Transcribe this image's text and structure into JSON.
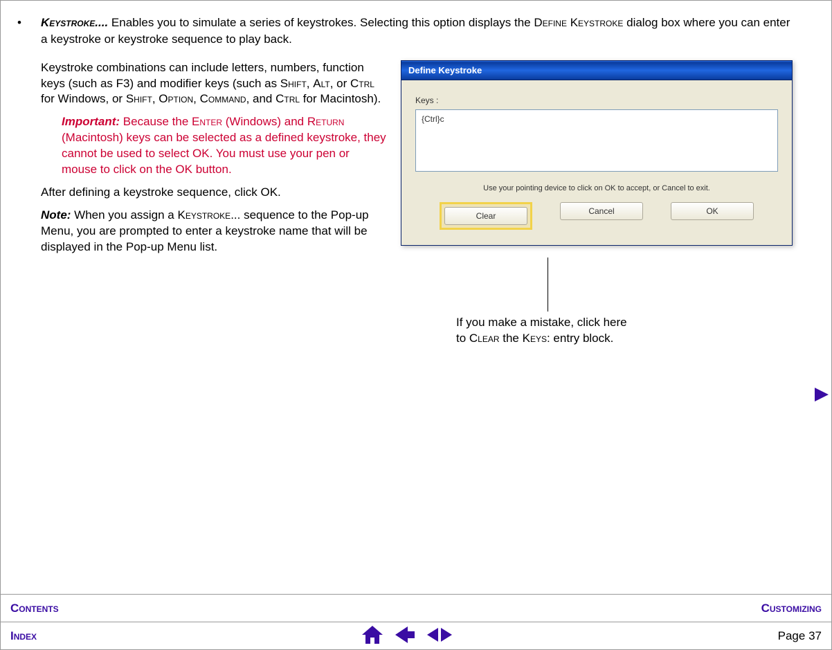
{
  "bullet": {
    "term": "Keystroke....",
    "desc_prefix": "Enables you to simulate a series of keystrokes.  Selecting this option displays the ",
    "desc_define": "Define Keystroke",
    "desc_suffix": " dialog box where you can enter a keystroke or keystroke sequence to play back."
  },
  "left": {
    "p1_a": "Keystroke combinations can include letters, numbers, function keys (such as F3) and modifier keys (such as ",
    "p1_shift": "Shift",
    "p1_b": ", ",
    "p1_alt": "Alt",
    "p1_c": ", or ",
    "p1_ctrl": "Ctrl",
    "p1_d": " for Windows, or ",
    "p1_shift2": "Shift",
    "p1_e": ", ",
    "p1_option": "Option",
    "p1_f": ", ",
    "p1_command": "Command",
    "p1_g": ", and ",
    "p1_ctrl2": "Ctrl",
    "p1_h": " for Macintosh).",
    "imp_label": "Important:",
    "imp_a": " Because the ",
    "imp_enter": "Enter",
    "imp_b": " (Windows) and ",
    "imp_return": "Return",
    "imp_c": " (Macintosh) keys can be selected as a defined keystroke, they cannot be used to select OK. You must use your pen or mouse to click on the OK button.",
    "p2": "After defining a keystroke sequence, click OK.",
    "note_label": "Note:",
    "note_a": " When you assign a ",
    "note_key": "Keystroke",
    "note_b": "... sequence to the Pop-up Menu, you are prompted to enter a keystroke name that will be displayed in the Pop-up Menu list."
  },
  "dialog": {
    "title": "Define Keystroke",
    "keys_label": "Keys :",
    "keys_value": "{Ctrl}c",
    "hint": "Use your pointing device to click on OK to accept, or Cancel to exit.",
    "clear": "Clear",
    "cancel": "Cancel",
    "ok": "OK"
  },
  "callout": {
    "l1": "If you make a mistake, click here",
    "l2_a": "to ",
    "l2_clear": "Clear",
    "l2_b": " the ",
    "l2_keys": "Keys",
    "l2_c": ": entry block."
  },
  "footer": {
    "contents": "Contents",
    "customizing": "Customizing",
    "index": "Index",
    "page_label": "Page  ",
    "page_num": "37"
  }
}
